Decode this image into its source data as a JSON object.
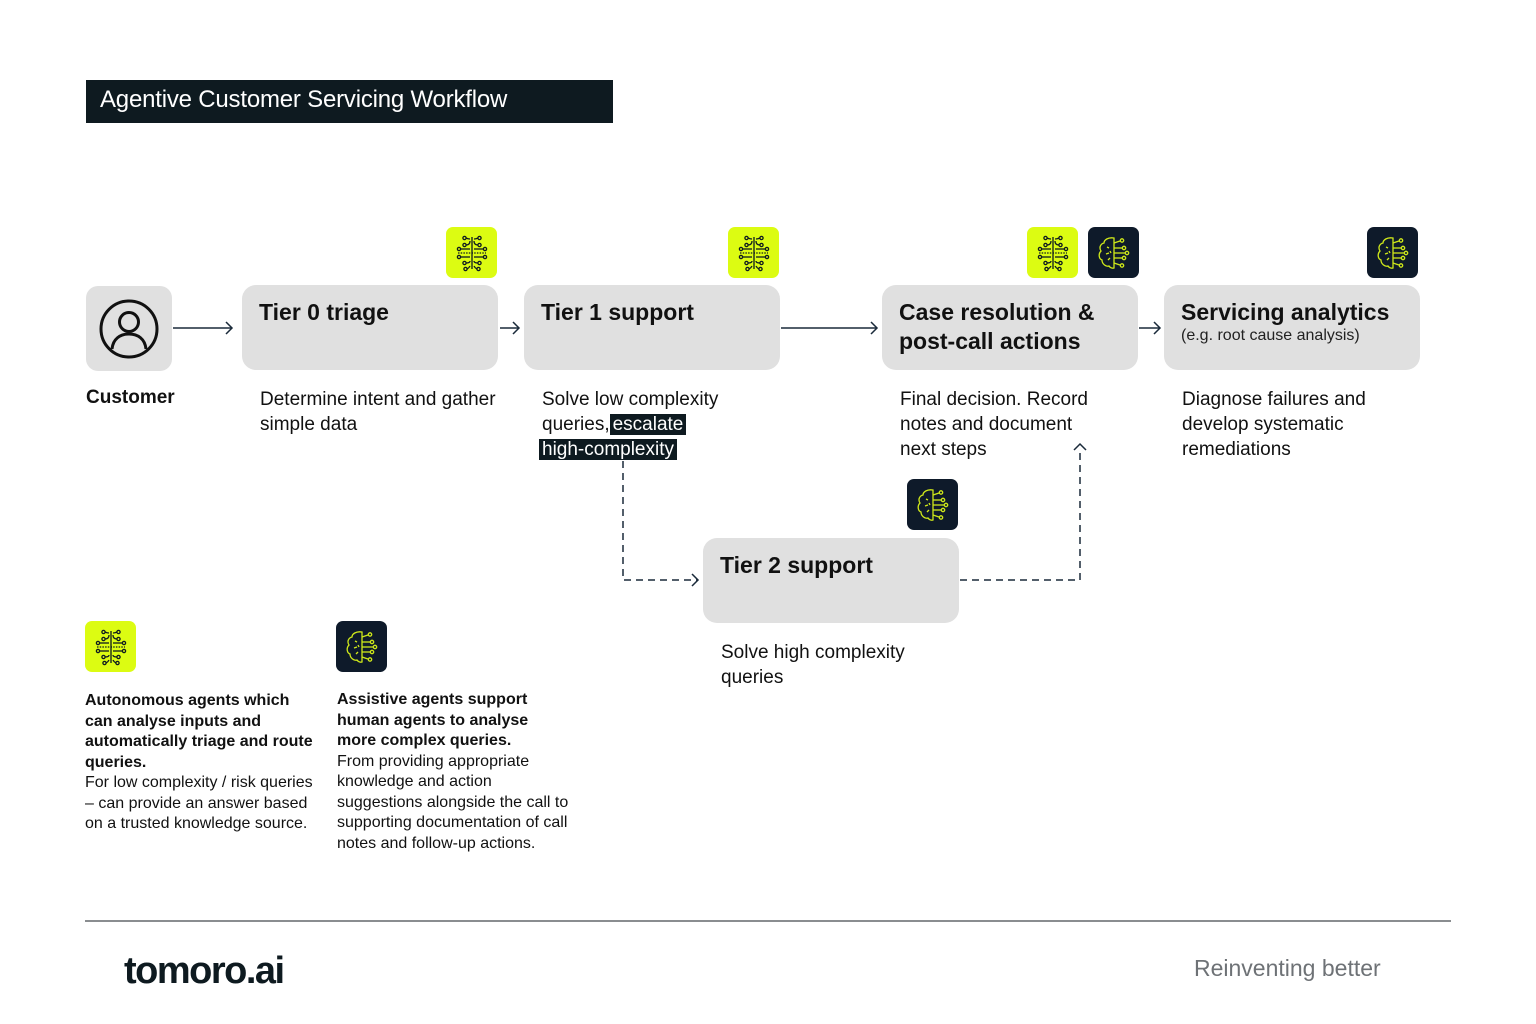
{
  "title": "Agentive Customer Servicing Workflow",
  "colors": {
    "dark": "#0e1a20",
    "lime": "#dcfc12",
    "box": "#e0e0e0",
    "divider": "#8a8d90",
    "tagline": "#6e7276"
  },
  "customer": {
    "label": "Customer",
    "icon": "user-circle-icon"
  },
  "steps": [
    {
      "id": "tier0",
      "title": "Tier 0 triage",
      "subtitle": "",
      "description": "Determine intent and gather simple data",
      "agents": [
        "autonomous"
      ]
    },
    {
      "id": "tier1",
      "title": "Tier 1 support",
      "subtitle": "",
      "description_plain": "Solve low complexity queries,",
      "description_highlight_1": "escalate",
      "description_highlight_2": "high-complexity",
      "agents": [
        "autonomous"
      ]
    },
    {
      "id": "case",
      "title_line1": "Case resolution &",
      "title_line2": "post-call actions",
      "description_line1": "Final decision. Record",
      "description_line2": "notes and document",
      "description_line3": "next steps",
      "agents": [
        "autonomous",
        "assistive"
      ]
    },
    {
      "id": "analytics",
      "title": "Servicing analytics",
      "subtitle": "(e.g. root cause analysis)",
      "description_line1": "Diagnose failures and",
      "description_line2": "develop systematic",
      "description_line3": "remediations",
      "agents": [
        "assistive"
      ]
    },
    {
      "id": "tier2",
      "title": "Tier 2 support",
      "description_line1": "Solve high complexity",
      "description_line2": "queries",
      "agents": [
        "assistive"
      ]
    }
  ],
  "legend": {
    "autonomous": {
      "icon": "circuit-chip-icon",
      "bold": "Autonomous agents which can analyse inputs and automatically triage and route queries.",
      "text": "For low complexity / risk queries – can provide an answer based on a trusted knowledge source."
    },
    "assistive": {
      "icon": "circuit-brain-icon",
      "bold": "Assistive agents support human agents to analyse more complex queries.",
      "text": "From providing appropriate knowledge and action suggestions alongside the call to supporting documentation of call notes and follow-up actions."
    }
  },
  "footer": {
    "logo": "tomoro.ai",
    "tagline": "Reinventing better"
  }
}
